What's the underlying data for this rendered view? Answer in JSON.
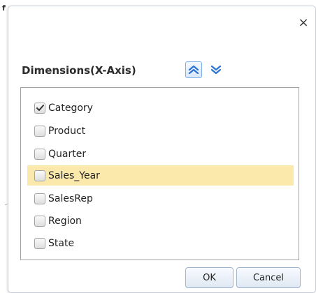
{
  "background": {
    "letter": "f"
  },
  "dialog": {
    "close_label": "×",
    "title": "Dimensions(X-Axis)",
    "move_up_icon": "chevron-double-up-icon",
    "move_down_icon": "chevron-double-down-icon",
    "items": [
      {
        "label": "Category",
        "checked": true,
        "highlighted": false
      },
      {
        "label": "Product",
        "checked": false,
        "highlighted": false
      },
      {
        "label": "Quarter",
        "checked": false,
        "highlighted": false
      },
      {
        "label": "Sales_Year",
        "checked": false,
        "highlighted": true
      },
      {
        "label": "SalesRep",
        "checked": false,
        "highlighted": false
      },
      {
        "label": "Region",
        "checked": false,
        "highlighted": false
      },
      {
        "label": "State",
        "checked": false,
        "highlighted": false
      }
    ],
    "ok_label": "OK",
    "cancel_label": "Cancel"
  },
  "colors": {
    "accent": "#2a73d4",
    "highlight": "#fbe9ac",
    "border": "#a0a0a0"
  }
}
